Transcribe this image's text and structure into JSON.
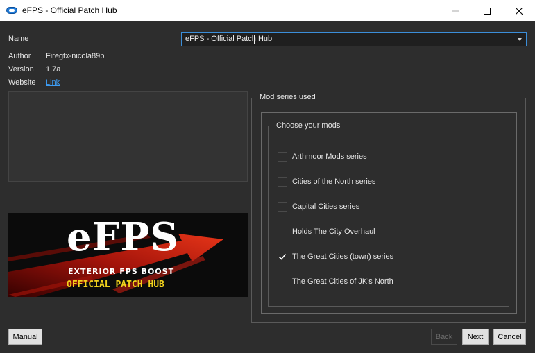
{
  "window": {
    "title": "eFPS - Official Patch Hub",
    "icon": "cloud-icon",
    "controls": {
      "minimize": "minimize-icon",
      "maximize": "maximize-icon",
      "close": "close-icon"
    }
  },
  "info": {
    "name_label": "Name",
    "name_value": "eFPS - Official Patch Hub",
    "author_label": "Author",
    "author_value": "Firegtx-nicola89b",
    "version_label": "Version",
    "version_value": "1.7a",
    "website_label": "Website",
    "website_link": "Link"
  },
  "banner": {
    "title": "eFPS",
    "subtitle": "EXTERIOR FPS BOOST",
    "tagline": "OFFICIAL PATCH HUB"
  },
  "mod_series": {
    "group_title": "Mod series used",
    "subgroup_title": "Choose your mods",
    "items": [
      {
        "label": "Arthmoor Mods series",
        "checked": false
      },
      {
        "label": "Cities of the North series",
        "checked": false
      },
      {
        "label": "Capital Cities series",
        "checked": false
      },
      {
        "label": "Holds The City Overhaul",
        "checked": false
      },
      {
        "label": "The Great Cities (town) series",
        "checked": true
      },
      {
        "label": "The Great Cities of JK's North",
        "checked": false
      }
    ]
  },
  "buttons": {
    "manual": "Manual",
    "back": "Back",
    "next": "Next",
    "cancel": "Cancel"
  },
  "colors": {
    "background": "#2d2d2d",
    "accent": "#3b8ed9",
    "link": "#3d9df5"
  }
}
